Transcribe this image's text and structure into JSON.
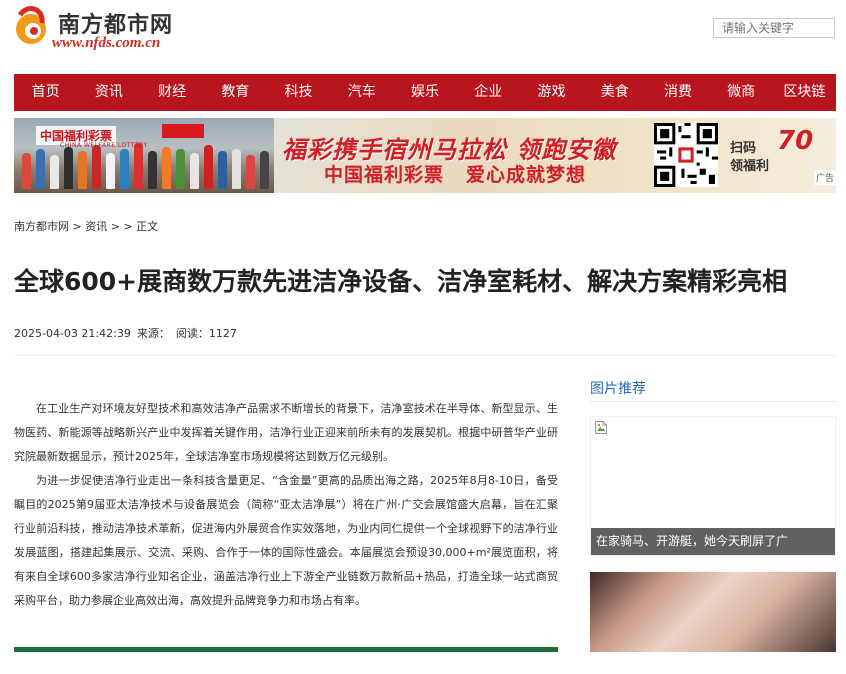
{
  "header": {
    "logo_cn": "南方都市网",
    "logo_en": "www.nfds.com.cn",
    "search_placeholder": "请输入关键字"
  },
  "nav": [
    "首页",
    "资讯",
    "财经",
    "教育",
    "科技",
    "汽车",
    "娱乐",
    "企业",
    "游戏",
    "美食",
    "消费",
    "微商",
    "区块链"
  ],
  "banner": {
    "brand": "中国福利彩票",
    "brand_en": "CHINA WELFARE LOTTERY",
    "slogan_main": "福彩携手宿州马拉松 领跑安徽",
    "slogan_sub_left": "中国福利彩票",
    "slogan_sub_right": "爱心成就梦想",
    "scan_line1": "扫码",
    "scan_line2": "领福利",
    "badge": "70",
    "ad_label": "广告"
  },
  "breadcrumb": {
    "home": "南方都市网",
    "sep1": " > ",
    "section": "资讯",
    "sep2": " > ",
    "sep3": " > ",
    "current": "正文"
  },
  "article": {
    "title": "全球600+展商数万款先进洁净设备、洁净室耗材、解决方案精彩亮相",
    "datetime": "2025-04-03 21:42:39",
    "source_label": "来源：",
    "reads_label": "阅读：",
    "reads": "1127",
    "paragraphs": [
      "在工业生产对环境友好型技术和高效洁净产品需求不断增长的背景下，洁净室技术在半导体、新型显示、生物医药、新能源等战略新兴产业中发挥着关键作用，洁净行业正迎来前所未有的发展契机。根据中研普华产业研究院最新数据显示，预计2025年，全球洁净室市场规模将达到数万亿元级别。",
      "为进一步促使洁净行业走出一条科技含量更足、“含金量”更高的品质出海之路，2025年8月8-10日，备受瞩目的2025第9届亚太洁净技术与设备展览会（简称“亚太洁净展”）将在广州·广交会展馆盛大启幕，旨在汇聚行业前沿科技，推动洁净技术革新，促进海内外展贸合作实效落地，为业内同仁提供一个全球视野下的洁净行业发展蓝图，搭建起集展示、交流、采购、合作于一体的国际性盛会。本届展览会预设30,000+m²展览面积，将有来自全球600多家洁净行业知名企业，涵盖洁净行业上下游全产业链数万款新品+热品，打造全球一站式商贸采购平台，助力参展企业高效出海，高效提升品牌竞争力和市场占有率。"
    ]
  },
  "sidebar": {
    "title": "图片推荐",
    "pic1_caption": "在家骑马、开游艇，她今天刷屏了广"
  },
  "colors": {
    "nav_red": "#b8161e",
    "link_blue": "#2a6bb8",
    "lottery_red": "#d21f26"
  }
}
